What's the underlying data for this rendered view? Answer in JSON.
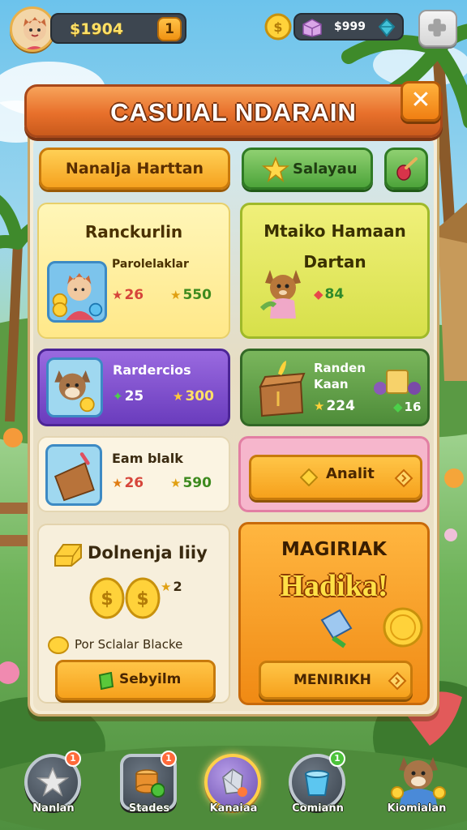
{
  "hud": {
    "coins": "$1904",
    "coins_add_label": "1",
    "gems": "$999",
    "coin_icon": "gold-coin-icon",
    "gem_icon": "gem-crate-icon",
    "settings_icon": "plus-icon"
  },
  "dialog": {
    "title": "CASUIAL NDARAIN",
    "close_label": "✕"
  },
  "tabs": {
    "primary": "Nanalja Harttan",
    "special": "Salayau",
    "extra_icon": "tool-icon"
  },
  "cards": {
    "c1": {
      "title": "Ranckurlin",
      "subtitle": "Parolelaklar",
      "gems": "26",
      "coins": "550"
    },
    "c2": {
      "title": "Mtaiko Hamaan",
      "subtitle": "Dartan",
      "gems": "84"
    },
    "c3": {
      "title": "Rardercios",
      "gems": "25",
      "coins": "300"
    },
    "c4": {
      "title": "Randen",
      "subtitle": "Kaan",
      "coins": "224",
      "extra": "16"
    },
    "c5": {
      "title": "Eam blalk",
      "gems": "26",
      "coins": "590"
    },
    "c6": {
      "button": "Analit"
    },
    "c7": {
      "title": "Dolnenja Iiiy",
      "multiplier": "2",
      "note": "Por Sclalar Blacke",
      "button": "Sebyilm"
    },
    "c8": {
      "title": "MAGIRIAK",
      "headline": "Hadika!",
      "button": "MENIRIKH"
    }
  },
  "nav": [
    {
      "label": "Nanlan",
      "badge": "1",
      "icon": "star-icon"
    },
    {
      "label": "Stades",
      "badge": "1",
      "icon": "coin-stack-icon"
    },
    {
      "label": "Kanaiaa",
      "badge": "",
      "icon": "crystal-icon"
    },
    {
      "label": "Comiann",
      "badge": "1",
      "icon": "bucket-icon"
    },
    {
      "label": "Kiomialan",
      "badge": "",
      "icon": "character-icon"
    }
  ],
  "colors": {
    "title_bar": "#e8702b",
    "primary_tab": "#f5a21f",
    "special_tab": "#4da43a",
    "gold": "#ffd23a",
    "gem_red": "#e8464a",
    "gem_green": "#3fbf4a"
  }
}
